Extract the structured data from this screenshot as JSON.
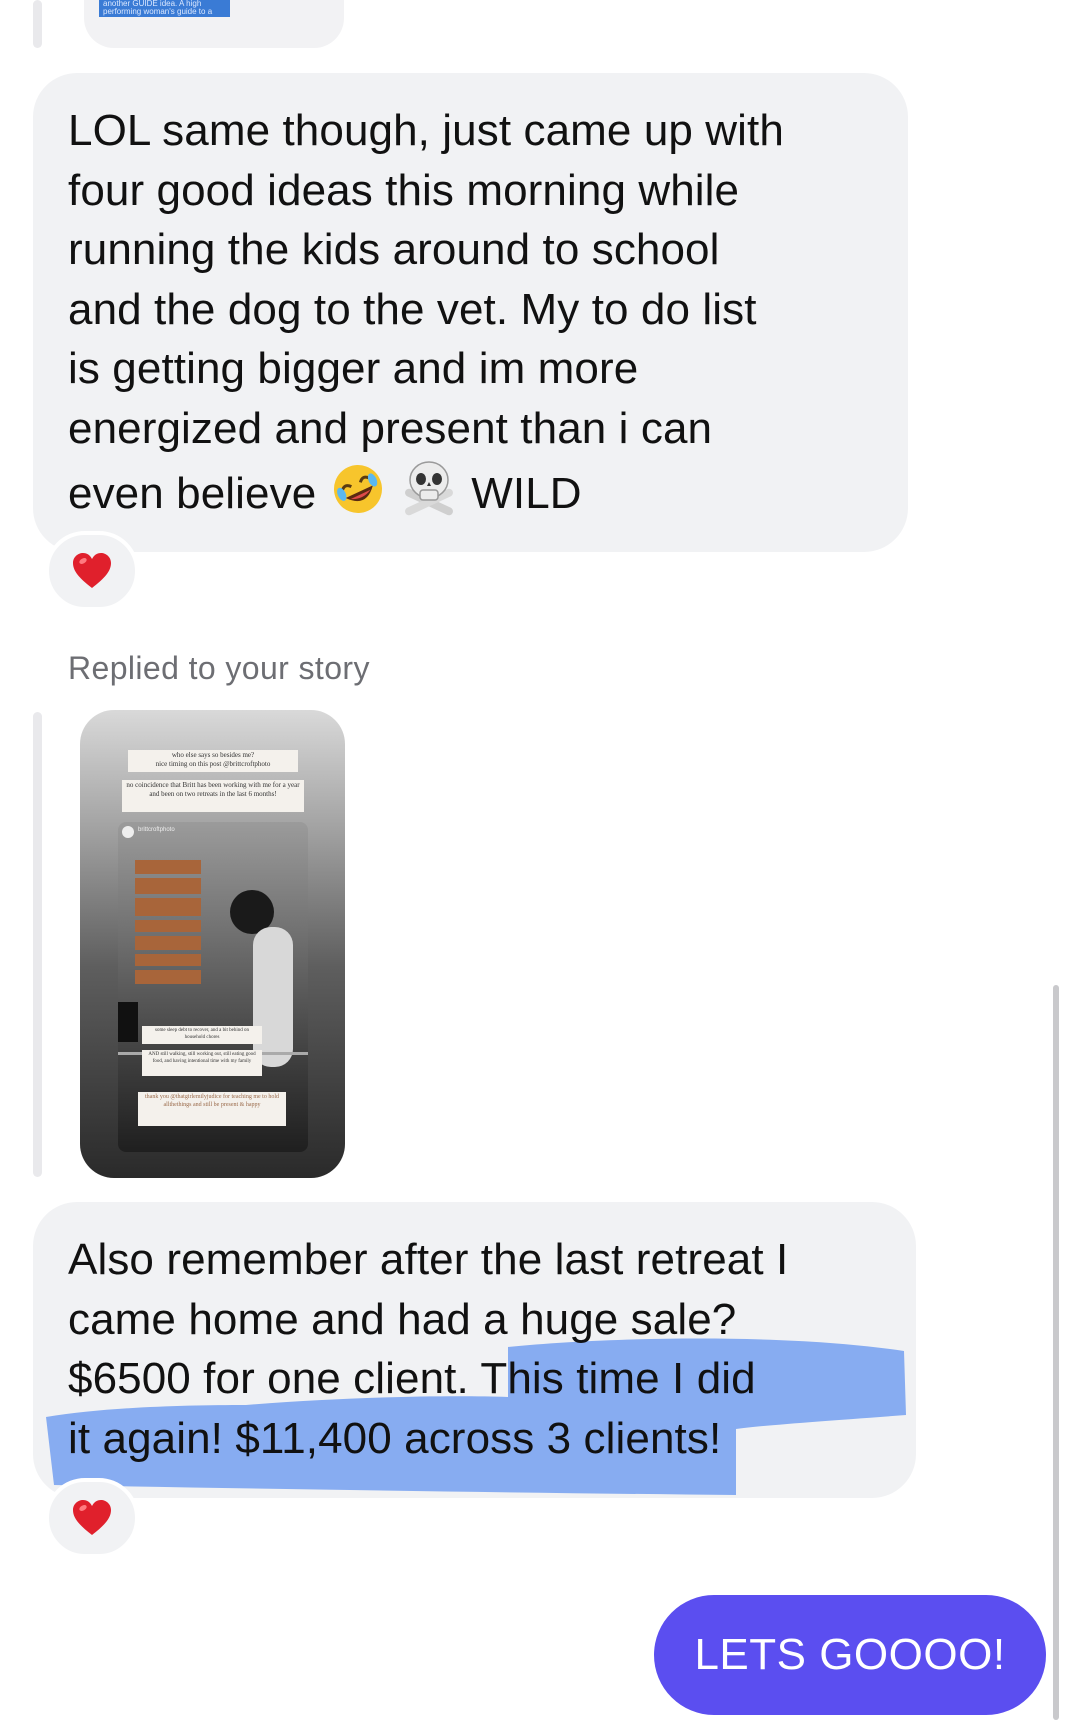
{
  "top_story": {
    "caption": "another GUIDE idea. A high performing woman's guide to a"
  },
  "messages": [
    {
      "id": "msg1",
      "lines": [
        "LOL same though, just came up with",
        "four good ideas this morning while",
        "running the kids around to school",
        "and the dog to the vet. My to do list",
        "is getting bigger and im more",
        "energized and present than i can"
      ],
      "last_line_prefix": "even believe",
      "last_line_suffix": "WILD",
      "emojis": [
        "rolling-on-floor-laughing-emoji",
        "skull-and-crossbones-emoji"
      ],
      "reaction": "red-heart"
    },
    {
      "id": "msg2",
      "lines": [
        "Also remember after the last retreat I",
        "came home and had a huge sale?",
        "$6500 for one client. This time I did",
        "it again! $11,400 across 3 clients!"
      ],
      "reaction": "red-heart"
    }
  ],
  "reply_context": {
    "label": "Replied to your story"
  },
  "story_preview": {
    "header_line1": "who else says so besides me?",
    "header_line2": "nice timing on this post @brittcroftphoto",
    "note": "no coincidence that Britt has been working with me for a year and been on two retreats in the last 6 months!",
    "account": "brittcroftphoto",
    "tags": [
      "",
      "",
      "",
      "",
      "",
      "",
      "",
      ""
    ],
    "bottom1": "some sleep debt to recover, and a bit behind on household chores",
    "bottom2": "AND still walking, still working out, still eating good food, and having intentional time with my family",
    "bottom3": "thank you @thatgirlemilyjudice for teaching me to hold allthethings and still be present & happy"
  },
  "sent_message": {
    "text": "LETS GOOOO!",
    "color": "#5b4ef0"
  },
  "colors": {
    "bubble": "#f1f2f4",
    "highlight": "#6f9cf0",
    "heart": "#e0202c"
  }
}
